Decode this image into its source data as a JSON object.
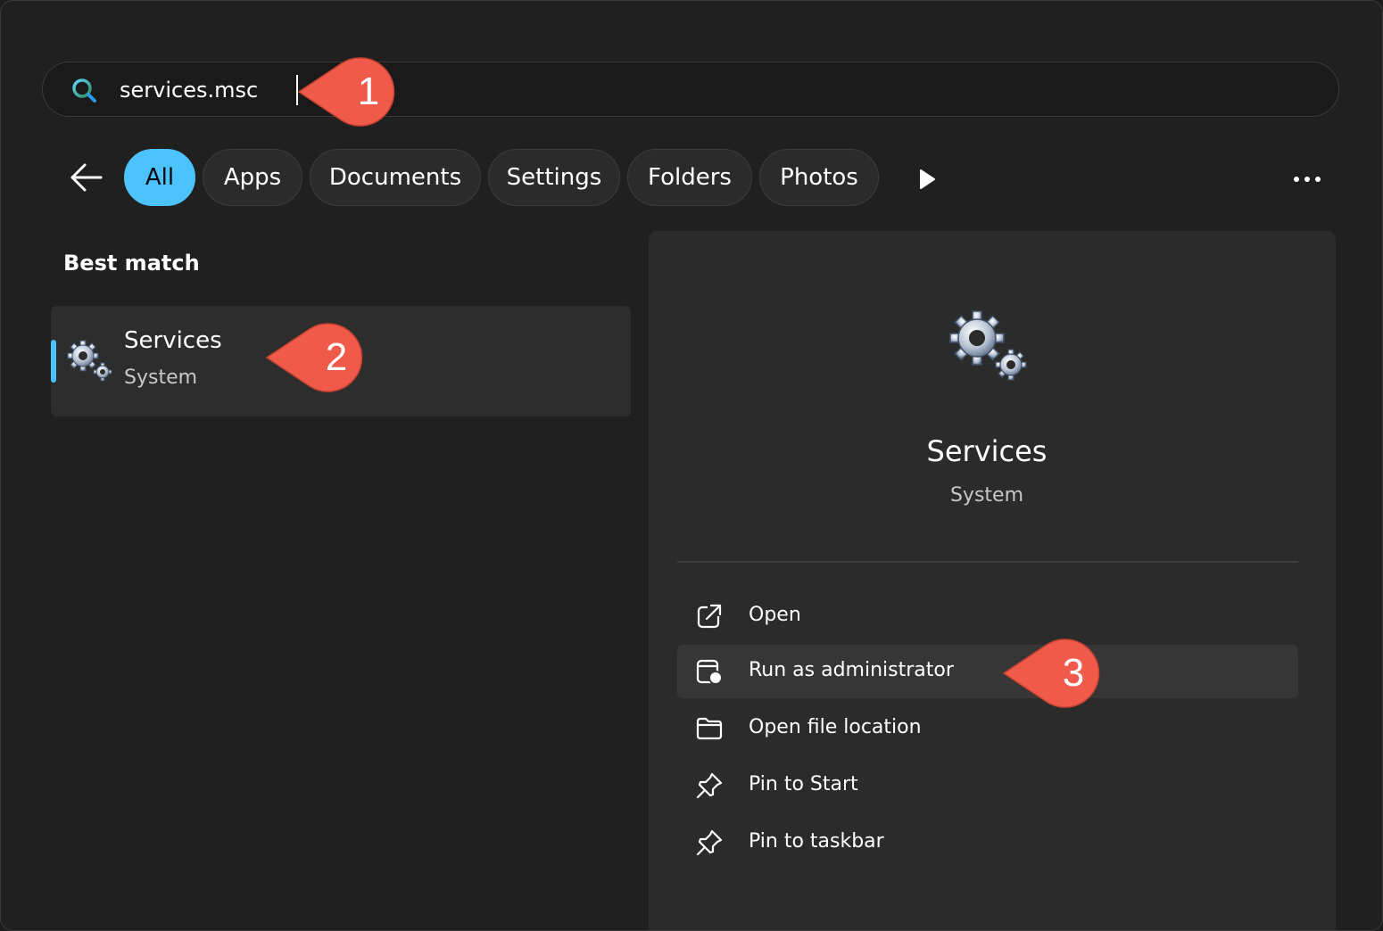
{
  "search": {
    "value": "services.msc",
    "icon": "search-icon"
  },
  "filters": {
    "back_icon": "back-arrow-icon",
    "chips": [
      "All",
      "Apps",
      "Documents",
      "Settings",
      "Folders",
      "Photos"
    ],
    "active": "All",
    "play_icon": "play-icon",
    "more_icon": "more-options-icon"
  },
  "best_match": {
    "section_title": "Best match",
    "item": {
      "title": "Services",
      "subtitle": "System",
      "icon": "gears-icon"
    }
  },
  "details": {
    "title": "Services",
    "subtitle": "System",
    "icon": "gears-icon",
    "actions": [
      {
        "label": "Open",
        "icon": "open-external-icon"
      },
      {
        "label": "Run as administrator",
        "icon": "run-as-admin-icon"
      },
      {
        "label": "Open file location",
        "icon": "folder-icon"
      },
      {
        "label": "Pin to Start",
        "icon": "pin-icon"
      },
      {
        "label": "Pin to taskbar",
        "icon": "pin-icon"
      }
    ]
  },
  "callouts": [
    "1",
    "2",
    "3"
  ],
  "colors": {
    "accent": "#4cc2ff",
    "callout": "#f05a4a",
    "background": "#202020",
    "pane": "#2b2b2b"
  }
}
